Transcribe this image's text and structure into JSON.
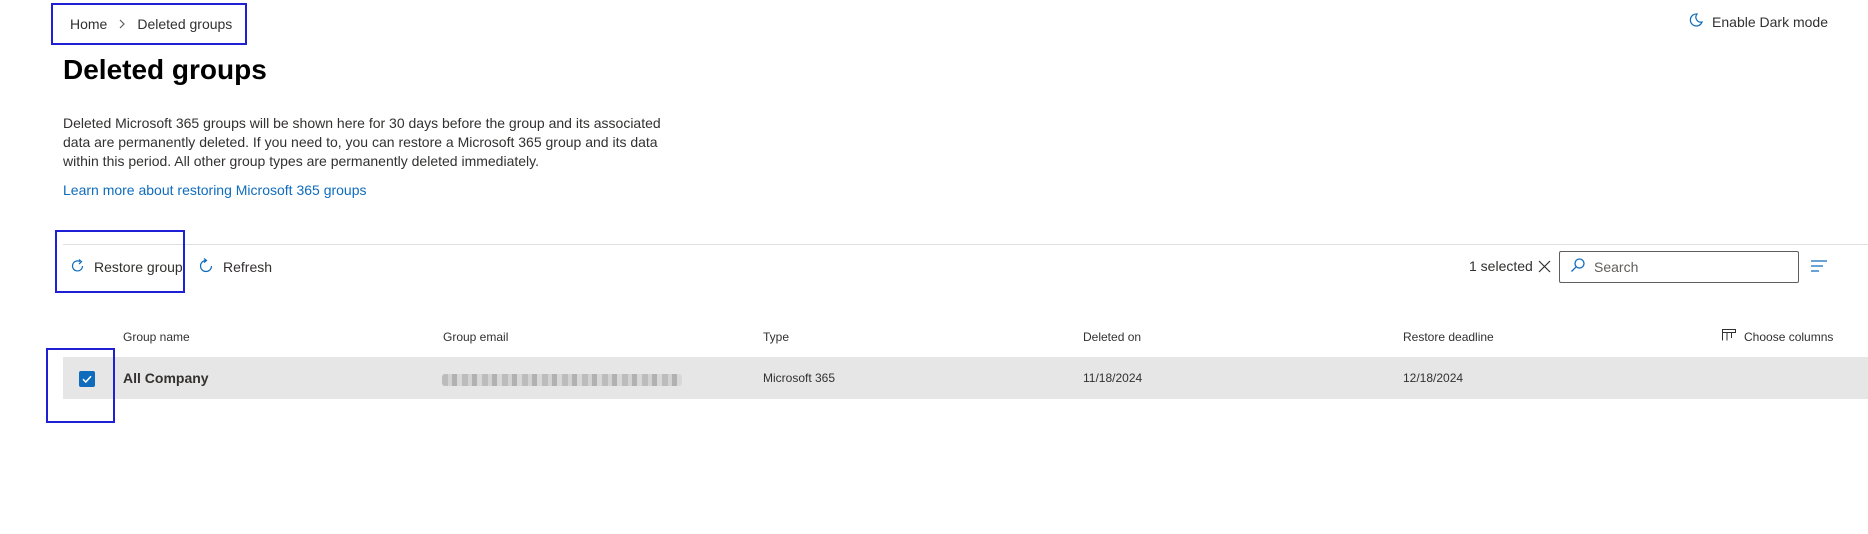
{
  "breadcrumb": {
    "home": "Home",
    "current": "Deleted groups"
  },
  "header": {
    "dark_mode_label": "Enable Dark mode",
    "dark_mode_icon": "moon-icon"
  },
  "page": {
    "title": "Deleted groups",
    "description": "Deleted Microsoft 365 groups will be shown here for 30 days before the group and its associated data are permanently deleted. If you need to, you can restore a Microsoft 365 group and its data within this period. All other group types are permanently deleted immediately.",
    "learn_link": "Learn more about restoring Microsoft 365 groups"
  },
  "toolbar": {
    "restore_label": "Restore group",
    "restore_icon": "redo-arrow-icon",
    "refresh_label": "Refresh",
    "refresh_icon": "refresh-icon",
    "selected_text": "1 selected",
    "search_placeholder": "Search"
  },
  "table": {
    "columns": [
      "Group name",
      "Group email",
      "Type",
      "Deleted on",
      "Restore deadline"
    ],
    "choose_columns_label": "Choose columns",
    "rows": [
      {
        "selected": true,
        "group_name": "All Company",
        "group_email": "(redacted)",
        "type": "Microsoft 365",
        "deleted_on": "11/18/2024",
        "restore_deadline": "12/18/2024"
      }
    ]
  },
  "colors": {
    "accent": "#0f6cbd",
    "annotation": "#1f1fd6",
    "selected_row": "#e7e6e6"
  }
}
